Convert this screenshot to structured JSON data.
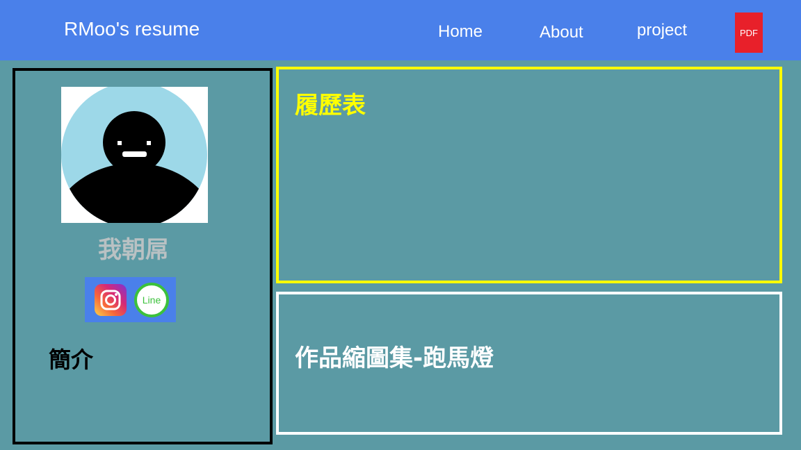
{
  "header": {
    "brand": "RMoo's resume",
    "nav": {
      "home": "Home",
      "about": "About",
      "project": "project"
    },
    "pdf_label": "PDF"
  },
  "profile": {
    "name": "我朝屌",
    "social": {
      "line_label": "Line"
    },
    "intro_heading": "簡介"
  },
  "sections": {
    "resume_title": "履歷表",
    "works_title": "作品縮圖集-跑馬燈"
  },
  "colors": {
    "header_bg": "#4a80ea",
    "page_bg": "#5b9aa4",
    "resume_border": "#ffff00",
    "pdf_bg": "#e8202a"
  }
}
